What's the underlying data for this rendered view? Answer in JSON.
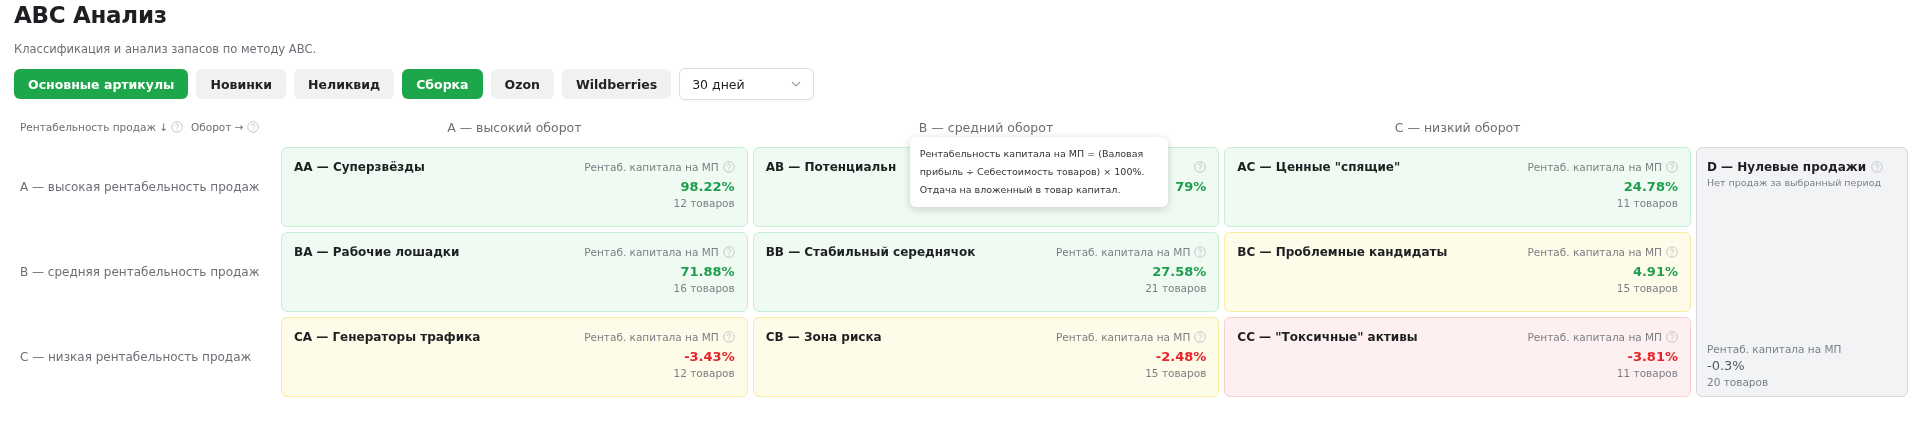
{
  "page": {
    "title": "АВС Анализ",
    "subtitle": "Классификация и анализ запасов по методу АВС."
  },
  "filters": [
    {
      "label": "Основные артикулы",
      "selected": true
    },
    {
      "label": "Новинки",
      "selected": false
    },
    {
      "label": "Неликвид",
      "selected": false
    },
    {
      "label": "Сборка",
      "selected": true
    },
    {
      "label": "Ozon",
      "selected": false
    },
    {
      "label": "Wildberries",
      "selected": false
    }
  ],
  "period": {
    "value": "30 дней"
  },
  "matrix": {
    "axis_labels": [
      "Рентабельность продаж ↓",
      "Оборот →"
    ],
    "columns": [
      "А — высокий оборот",
      "В — средний оборот",
      "С — низкий оборот"
    ],
    "rows": [
      {
        "label": "А — высокая рентабельность продаж",
        "cells": [
          {
            "title": "АА — Суперзвёзды",
            "label": "Рентаб. капитала на МП",
            "metric": {
              "value": "98.22%",
              "color": "#1f9d4f"
            },
            "count": "12 товаров",
            "color": "#effbf2"
          },
          {
            "title": "АВ — Потенциальн",
            "metric": {
              "value": "79%",
              "color": "#1f9d4f"
            },
            "color": "#effbf2",
            "tooltip": "Рентабельность капитала на МП = (Валовая\nприбыль ÷ Себестоимость товаров) × 100%.\nОтдача на вложенный в товар капитал."
          },
          {
            "title": "АС — Ценные \"спящие\"",
            "label": "Рентаб. капитала на МП",
            "metric": {
              "value": "24.78%",
              "color": "#1f9d4f"
            },
            "count": "11 товаров",
            "color": "#effbf2"
          }
        ]
      },
      {
        "label": "В — средняя рентабельность продаж",
        "cells": [
          {
            "title": "ВА — Рабочие лошадки",
            "label": "Рентаб. капитала на МП",
            "metric": {
              "value": "71.88%",
              "color": "#1f9d4f"
            },
            "count": "16 товаров",
            "color": "#effbf2"
          },
          {
            "title": "ВВ — Стабильный середнячок",
            "label": "Рентаб. капитала на МП",
            "metric": {
              "value": "27.58%",
              "color": "#1f9d4f"
            },
            "count": "21 товаров",
            "color": "#effbf2"
          },
          {
            "title": "ВС — Проблемные кандидаты",
            "label": "Рентаб. капитала на МП",
            "metric": {
              "value": "4.91%",
              "color": "#1f9d4f"
            },
            "count": "15 товаров",
            "color": "#fefbe8"
          }
        ]
      },
      {
        "label": "С — низкая рентабельность продаж",
        "cells": [
          {
            "title": "СА — Генераторы трафика",
            "label": "Рентаб. капитала на МП",
            "metric": {
              "value": "-3.43%",
              "color": "#e3242b"
            },
            "count": "12 товаров",
            "color": "#fefbe8"
          },
          {
            "title": "СВ — Зона риска",
            "label": "Рентаб. капитала на МП",
            "metric": {
              "value": "-2.48%",
              "color": "#e3242b"
            },
            "count": "15 товаров",
            "color": "#fefbe8"
          },
          {
            "title": "СС — \"Токсичные\" активы",
            "label": "Рентаб. капитала на МП",
            "metric": {
              "value": "-3.81%",
              "color": "#e3242b"
            },
            "count": "11 товаров",
            "color": "#fef0f0"
          }
        ]
      }
    ],
    "zero_sales": {
      "title": "D — Нулевые продажи",
      "subtitle": "Нет продаж за выбранный период",
      "label": "Рентаб. капитала на МП",
      "metric": {
        "value": "-0.3%",
        "color": "#555a60"
      },
      "count": "20 товаров",
      "color": "#f2f3f5"
    }
  }
}
